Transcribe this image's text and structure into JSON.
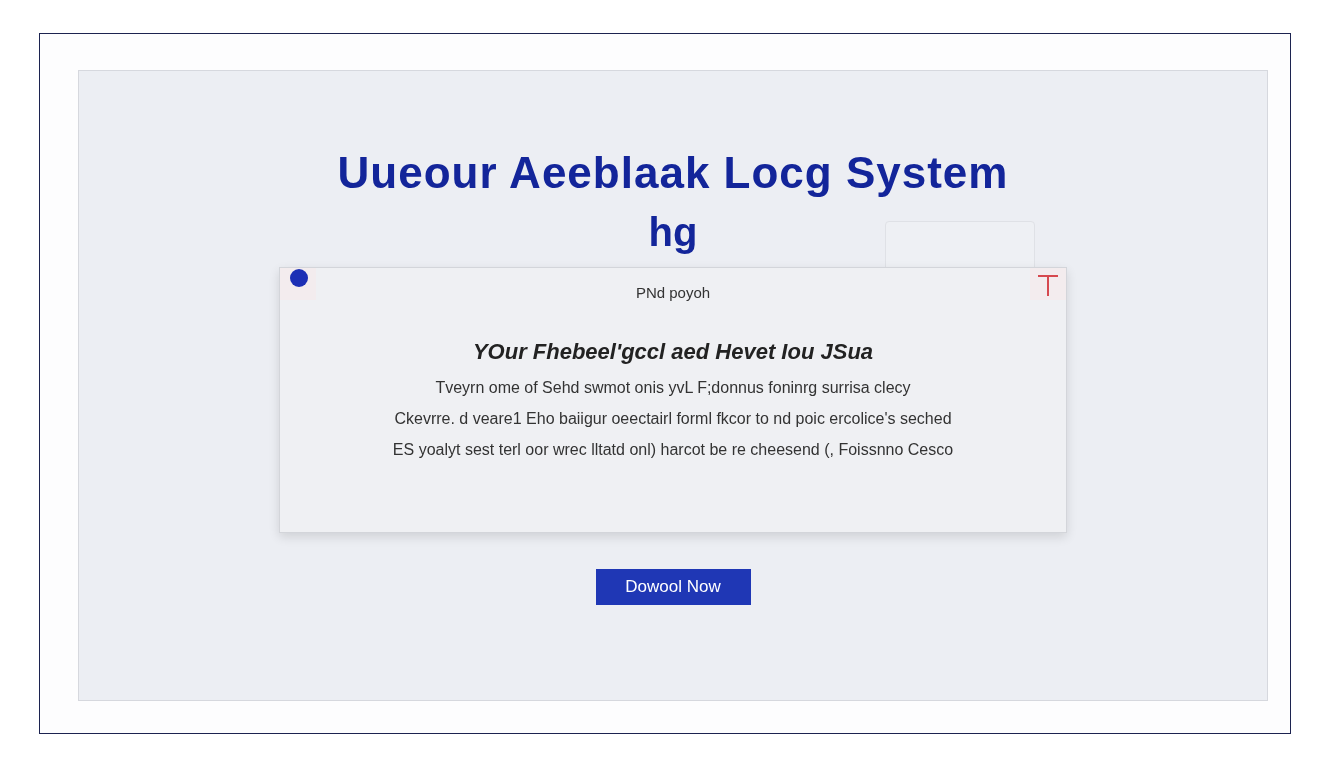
{
  "header": {
    "title": "Uueour Aeeblaak Locg System",
    "subtitle": "hg"
  },
  "card": {
    "caption": "PNd poyoh",
    "heading": "YOur Fhebeel'gccl aed Hevet  Iou JSua",
    "lines": [
      "Tveyrn ome of Sehd swmot onis yvL F;donnus foninrg surrisa clecy",
      "Ckevrre. d veare1 Eho baiigur oeectairl forml fkcor  to nd poic ercolice's seched",
      "ES yoalyt sest terl oor wrec lltatd onl) harcot be re cheesend (, Foissnno Cesco"
    ]
  },
  "button": {
    "label": "Dowool Now"
  }
}
